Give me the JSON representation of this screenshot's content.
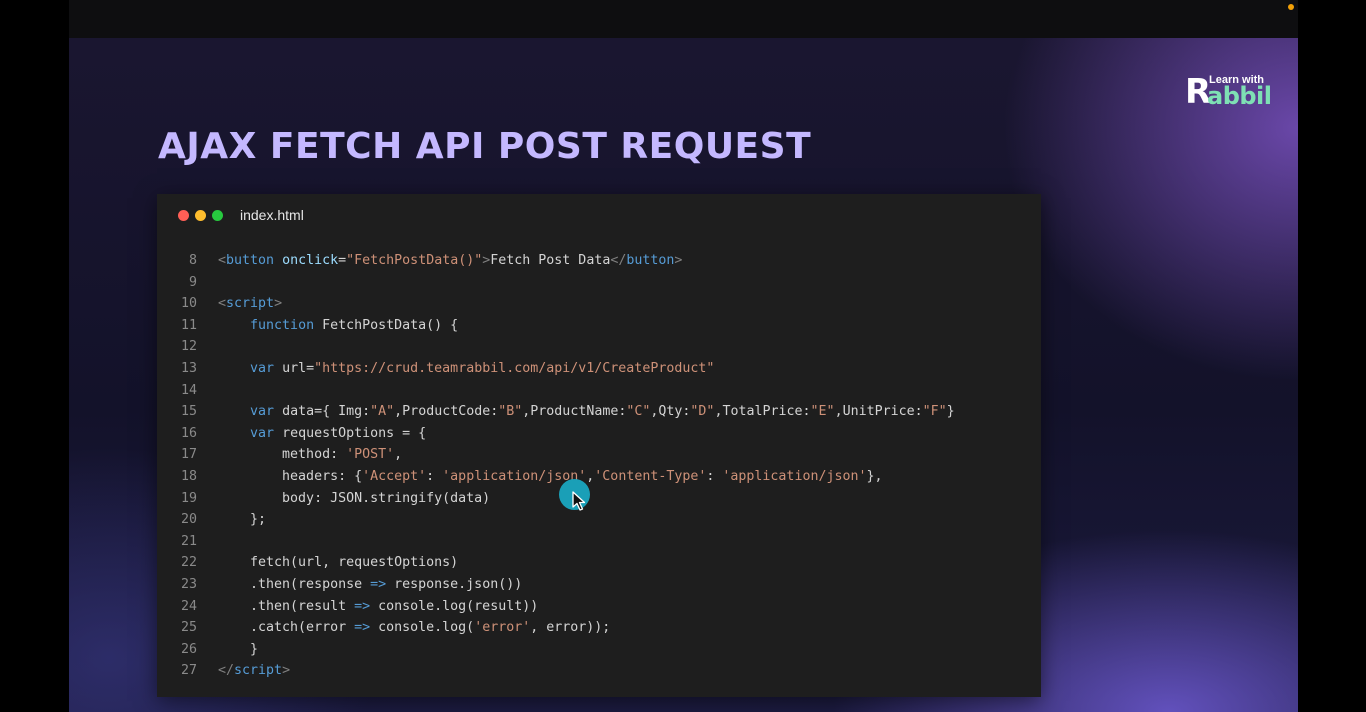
{
  "slide": {
    "title": "AJAX FETCH API POST REQUEST",
    "logo": {
      "line1": "Learn with",
      "mark": "R",
      "line2": "abbil"
    }
  },
  "editor": {
    "filename": "index.html",
    "lines": [
      {
        "n": "8",
        "tokens": [
          [
            "tag",
            "<"
          ],
          [
            "tagname",
            "button"
          ],
          [
            "plain",
            " "
          ],
          [
            "attr",
            "onclick"
          ],
          [
            "plain",
            "="
          ],
          [
            "str",
            "\"FetchPostData()\""
          ],
          [
            "tag",
            ">"
          ],
          [
            "plain",
            "Fetch Post Data"
          ],
          [
            "tag",
            "</"
          ],
          [
            "tagname",
            "button"
          ],
          [
            "tag",
            ">"
          ]
        ]
      },
      {
        "n": "9",
        "tokens": []
      },
      {
        "n": "10",
        "tokens": [
          [
            "tag",
            "<"
          ],
          [
            "tagname",
            "script"
          ],
          [
            "tag",
            ">"
          ]
        ]
      },
      {
        "n": "11",
        "tokens": [
          [
            "plain",
            "    "
          ],
          [
            "kw",
            "function"
          ],
          [
            "plain",
            " FetchPostData() {"
          ]
        ]
      },
      {
        "n": "12",
        "tokens": []
      },
      {
        "n": "13",
        "tokens": [
          [
            "plain",
            "    "
          ],
          [
            "kw",
            "var"
          ],
          [
            "plain",
            " url="
          ],
          [
            "str",
            "\"https://crud.teamrabbil.com/api/v1/CreateProduct\""
          ]
        ]
      },
      {
        "n": "14",
        "tokens": []
      },
      {
        "n": "15",
        "tokens": [
          [
            "plain",
            "    "
          ],
          [
            "kw",
            "var"
          ],
          [
            "plain",
            " data={ Img:"
          ],
          [
            "str",
            "\"A\""
          ],
          [
            "plain",
            ",ProductCode:"
          ],
          [
            "str",
            "\"B\""
          ],
          [
            "plain",
            ",ProductName:"
          ],
          [
            "str",
            "\"C\""
          ],
          [
            "plain",
            ",Qty:"
          ],
          [
            "str",
            "\"D\""
          ],
          [
            "plain",
            ",TotalPrice:"
          ],
          [
            "str",
            "\"E\""
          ],
          [
            "plain",
            ",UnitPrice:"
          ],
          [
            "str",
            "\"F\""
          ],
          [
            "plain",
            "}"
          ]
        ]
      },
      {
        "n": "16",
        "tokens": [
          [
            "plain",
            "    "
          ],
          [
            "kw",
            "var"
          ],
          [
            "plain",
            " requestOptions = {"
          ]
        ]
      },
      {
        "n": "17",
        "tokens": [
          [
            "plain",
            "        method: "
          ],
          [
            "str",
            "'POST'"
          ],
          [
            "plain",
            ","
          ]
        ]
      },
      {
        "n": "18",
        "tokens": [
          [
            "plain",
            "        headers: {"
          ],
          [
            "str",
            "'Accept'"
          ],
          [
            "plain",
            ": "
          ],
          [
            "str",
            "'application/json'"
          ],
          [
            "plain",
            ","
          ],
          [
            "str",
            "'Content-Type'"
          ],
          [
            "plain",
            ": "
          ],
          [
            "str",
            "'application/json'"
          ],
          [
            "plain",
            "},"
          ]
        ]
      },
      {
        "n": "19",
        "tokens": [
          [
            "plain",
            "        body: JSON.stringify(data)"
          ]
        ]
      },
      {
        "n": "20",
        "tokens": [
          [
            "plain",
            "    };"
          ]
        ]
      },
      {
        "n": "21",
        "tokens": []
      },
      {
        "n": "22",
        "tokens": [
          [
            "plain",
            "    fetch(url, requestOptions)"
          ]
        ]
      },
      {
        "n": "23",
        "tokens": [
          [
            "plain",
            "    .then(response "
          ],
          [
            "kw",
            "=>"
          ],
          [
            "plain",
            " response.json())"
          ]
        ]
      },
      {
        "n": "24",
        "tokens": [
          [
            "plain",
            "    .then(result "
          ],
          [
            "kw",
            "=>"
          ],
          [
            "plain",
            " console.log(result))"
          ]
        ]
      },
      {
        "n": "25",
        "tokens": [
          [
            "plain",
            "    .catch(error "
          ],
          [
            "kw",
            "=>"
          ],
          [
            "plain",
            " console.log("
          ],
          [
            "str",
            "'error'"
          ],
          [
            "plain",
            ", error));"
          ]
        ]
      },
      {
        "n": "26",
        "tokens": [
          [
            "plain",
            "    }"
          ]
        ]
      },
      {
        "n": "27",
        "tokens": [
          [
            "tag",
            "</"
          ],
          [
            "tagname",
            "script"
          ],
          [
            "tag",
            ">"
          ]
        ]
      }
    ]
  },
  "colors": {
    "title": "#c4b8ff",
    "logo_accent": "#7ee0b4",
    "editor_bg": "#1e1e1e",
    "cursor_highlight": "#1aa7c0",
    "recording_dot": "#f2a007"
  },
  "icons": {
    "window_controls": [
      "close-dot-icon",
      "minimize-dot-icon",
      "maximize-dot-icon"
    ],
    "pointer": "mouse-pointer-icon",
    "recording": "recording-indicator-icon"
  }
}
